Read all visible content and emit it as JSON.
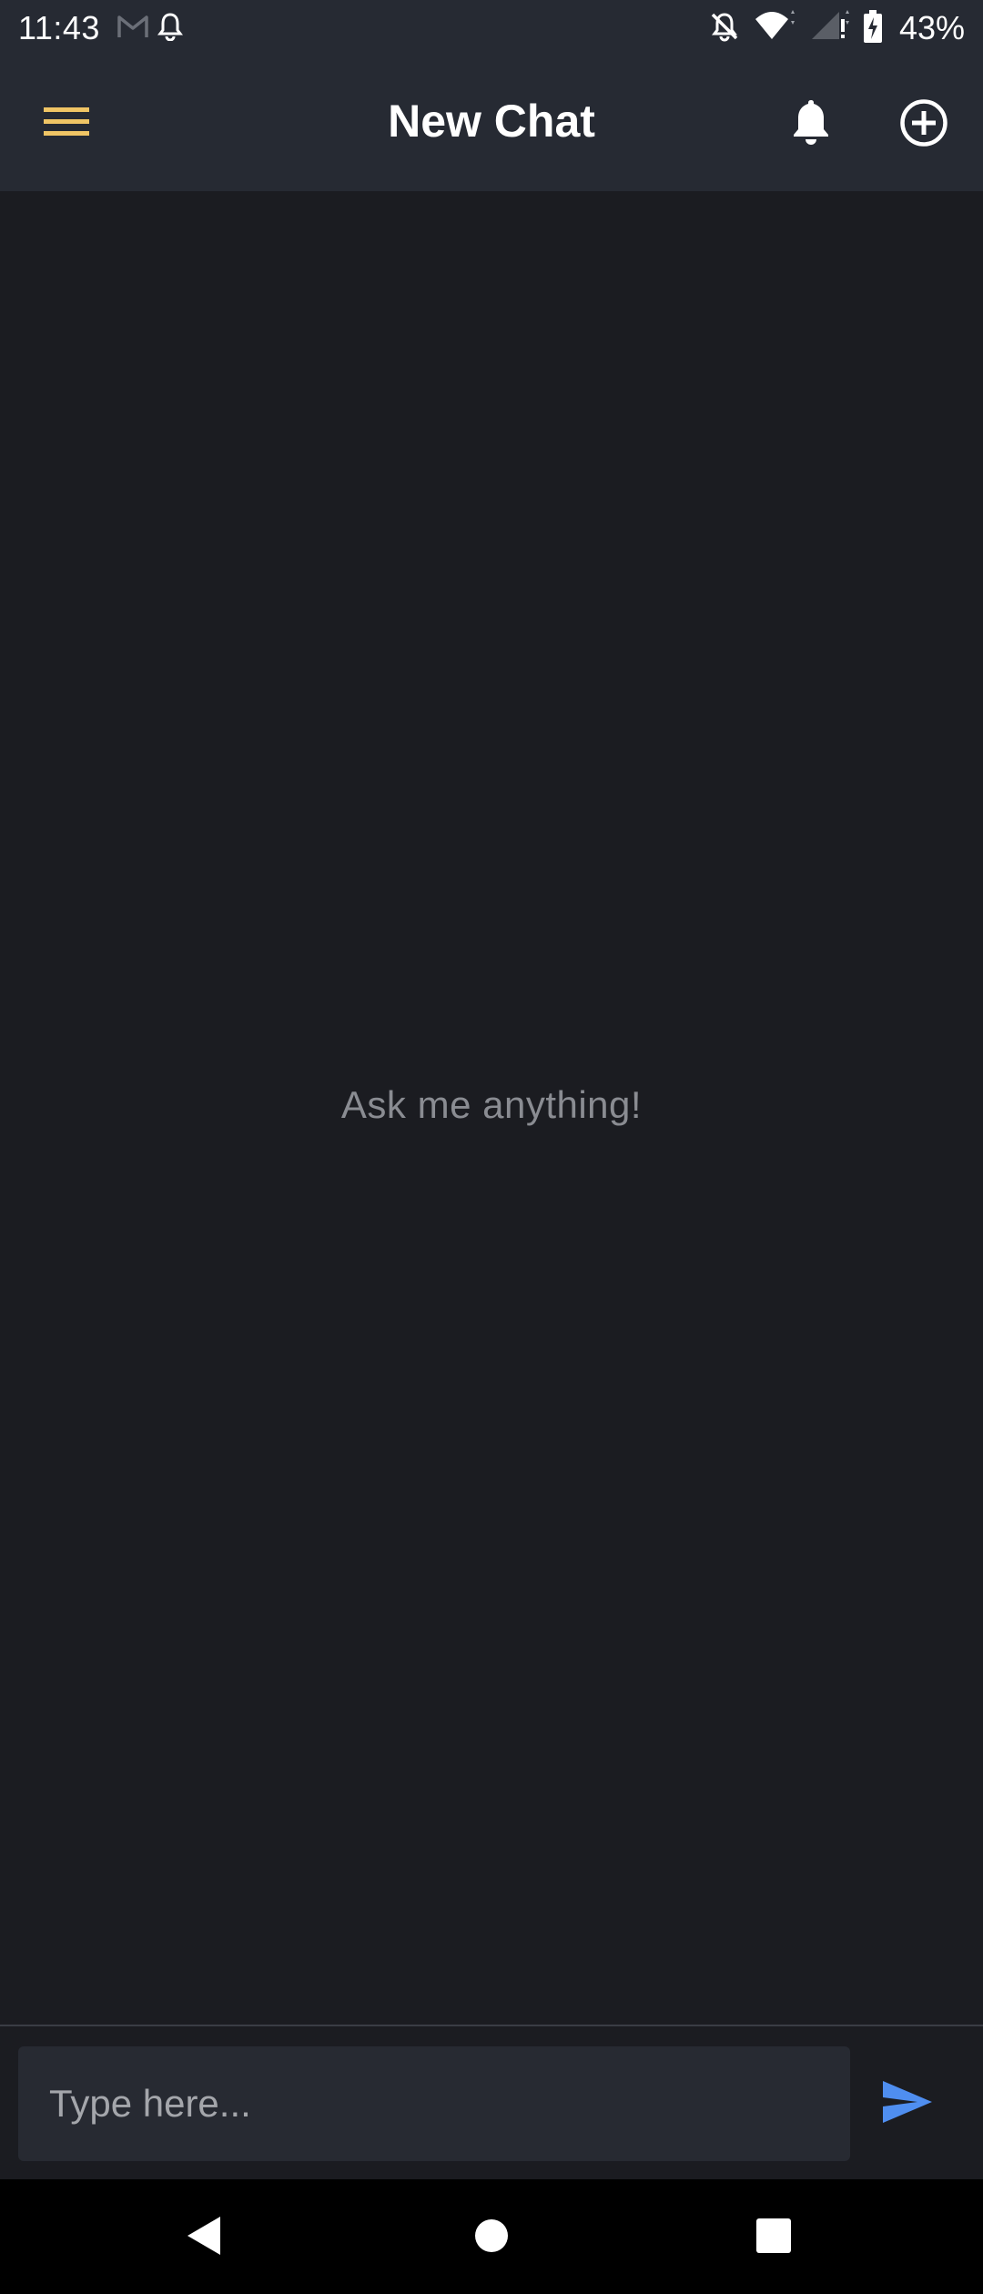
{
  "status_bar": {
    "time": "11:43",
    "battery_percent": "43%",
    "left_icons": [
      "gmail-icon",
      "alarm-bell-icon"
    ],
    "right_icons": [
      "notifications-off-icon",
      "wifi-icon",
      "signal-icon",
      "battery-charging-icon"
    ]
  },
  "app_bar": {
    "title": "New Chat",
    "menu_icon": "hamburger-menu-icon",
    "menu_color": "#f0c565",
    "bell_icon": "bell-icon",
    "add_icon": "add-circle-icon"
  },
  "chat": {
    "empty_hint": "Ask me anything!"
  },
  "composer": {
    "placeholder": "Type here...",
    "value": "",
    "send_icon": "send-icon",
    "send_color": "#4f8ef0"
  },
  "nav_bar": {
    "back_icon": "back-triangle-icon",
    "home_icon": "home-circle-icon",
    "recents_icon": "recents-square-icon"
  },
  "colors": {
    "app_bar_bg": "#262a33",
    "background": "#1b1c21",
    "input_bg": "#272a32"
  }
}
